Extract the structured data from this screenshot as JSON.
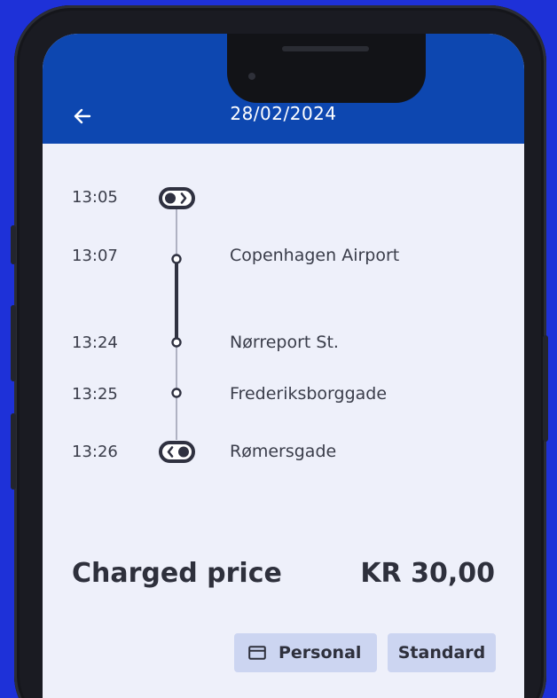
{
  "header": {
    "date": "28/02/2024",
    "back_icon": "arrow-left-icon"
  },
  "journey": {
    "rows": [
      {
        "time": "13:05",
        "stop": "",
        "marker": "transit-start-icon"
      },
      {
        "time": "13:07",
        "stop": "Copenhagen Airport",
        "marker": "stop-dot"
      },
      {
        "time": "13:24",
        "stop": "Nørreport St.",
        "marker": "stop-dot"
      },
      {
        "time": "13:25",
        "stop": "Frederiksborggade",
        "marker": "stop-dot"
      },
      {
        "time": "13:26",
        "stop": "Rømersgade",
        "marker": "transit-end-icon"
      }
    ]
  },
  "price": {
    "label": "Charged price",
    "value": "KR 30,00"
  },
  "chips": {
    "personal": "Personal",
    "standard": "Standard",
    "personal_icon": "credit-card-icon"
  },
  "colors": {
    "background": "#1e31d8",
    "appbar": "#0d47b0",
    "screen": "#eef0fa",
    "text": "#2e303c",
    "chip": "#ccd5f1"
  }
}
